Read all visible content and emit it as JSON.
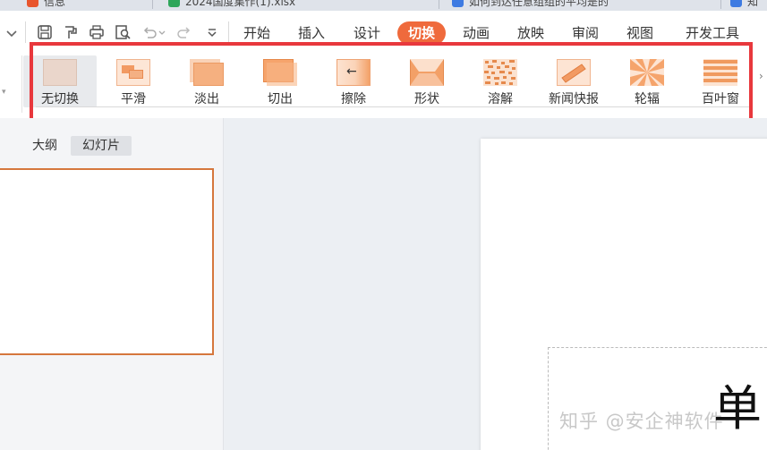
{
  "browser_tabs": [
    {
      "title": "信息",
      "icon_color": "#e8552d"
    },
    {
      "title": "2024国度集作(1).xlsx",
      "icon_color": "#2ea65a"
    },
    {
      "title": "如何到达任意组组的平均是的",
      "icon_color": "#3e7be2"
    },
    {
      "title": "知",
      "icon_color": "#3e7be2"
    }
  ],
  "quick_access": [
    {
      "name": "save-icon"
    },
    {
      "name": "format-painter-icon"
    },
    {
      "name": "print-icon"
    },
    {
      "name": "print-preview-icon"
    },
    {
      "name": "undo-icon"
    },
    {
      "name": "redo-icon"
    },
    {
      "name": "customize-dropdown-icon"
    }
  ],
  "menu_tabs": [
    "开始",
    "插入",
    "设计",
    "切换",
    "动画",
    "放映",
    "审阅",
    "视图",
    "开发工具"
  ],
  "active_menu_tab": "切换",
  "transitions": [
    {
      "label": "无切换",
      "icon": "no-transition-icon",
      "selected": true
    },
    {
      "label": "平滑",
      "icon": "smooth-icon"
    },
    {
      "label": "淡出",
      "icon": "fade-icon"
    },
    {
      "label": "切出",
      "icon": "cut-icon"
    },
    {
      "label": "擦除",
      "icon": "wipe-icon"
    },
    {
      "label": "形状",
      "icon": "shape-icon"
    },
    {
      "label": "溶解",
      "icon": "dissolve-icon"
    },
    {
      "label": "新闻快报",
      "icon": "newsflash-icon"
    },
    {
      "label": "轮辐",
      "icon": "wheel-icon"
    },
    {
      "label": "百叶窗",
      "icon": "blinds-icon"
    }
  ],
  "panel_tabs": {
    "outline": "大纲",
    "slides": "幻灯片"
  },
  "watermark": "知乎 @安企神软件",
  "big_char": "单",
  "colors": {
    "accent": "#ef6a3c",
    "highlight": "#e8383d",
    "thumb_orange": "#f0a070",
    "slide_border": "#d5773d"
  }
}
